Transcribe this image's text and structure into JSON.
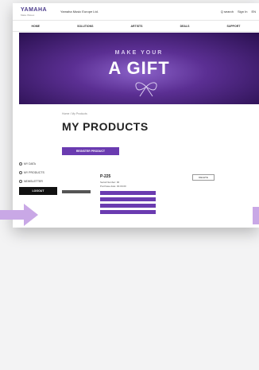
{
  "header": {
    "logo": "YAMAHA",
    "logo_sub": "Make Waves",
    "site_title": "Yamaha Music Europe Ltd.",
    "links": [
      "Q search",
      "Sign In",
      "EN"
    ]
  },
  "nav": {
    "items": [
      "HOME",
      "SOLUTIONS",
      "ARTISTS",
      "DEALS",
      "SUPPORT"
    ]
  },
  "banner": {
    "subtitle": "MAKE YOUR",
    "title": "A GIFT"
  },
  "breadcrumb": "Home / My Products",
  "page_title": "MY PRODUCTS",
  "register_button": "REGISTER PRODUCT",
  "sidebar": {
    "items": [
      "MY DATA",
      "MY PRODUCTS",
      "NEWSLETTER"
    ],
    "logout": "LOGOUT"
  },
  "product": {
    "name": "P-225",
    "meta": [
      "Serial Number: 00",
      "Purchase date: 00.00.00"
    ],
    "actions": [
      "",
      "",
      "",
      ""
    ],
    "edit": "DELETE"
  },
  "colors": {
    "accent": "#6a3bb0",
    "banner_dark": "#2a1050",
    "arrow": "#c9a8e6"
  }
}
